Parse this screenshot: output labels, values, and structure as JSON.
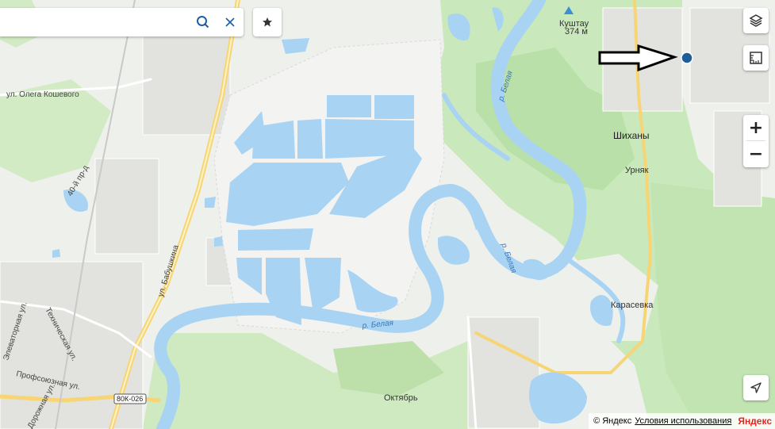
{
  "search": {
    "placeholder": ""
  },
  "map": {
    "places": {
      "kushtau": "Куштау",
      "kushtau_elev": "374 м",
      "shikhany": "Шиханы",
      "urnyak": "Урняк",
      "karasevka": "Карасевка",
      "oktyabr": "Октябрь"
    },
    "rivers": {
      "belaya_1": "р. Белая",
      "belaya_2": "р. Белая",
      "belaya_3": "р. Белая"
    },
    "streets": {
      "koshevogo": "ул. Олега Кошевого",
      "pr40": "40-й пр-д",
      "babushkina": "ул. Бабушкина",
      "elevatornaya": "Элеваторная ул.",
      "tekhnicheskaya": "Техническая ул.",
      "profsoyuznaya": "Профсоюзная ул.",
      "dorozhnaya": "Дорожная ул."
    },
    "road_shield": "80К-026"
  },
  "footer": {
    "copyright": "© Яндекс",
    "terms": "Условия использования",
    "brand": "Яндекс"
  },
  "colors": {
    "water": "#a9d3f3",
    "forest": "#c5e6b6",
    "forest_dark": "#b0dca0",
    "road_major": "#f7d575",
    "marker": "#1e5c9a"
  }
}
